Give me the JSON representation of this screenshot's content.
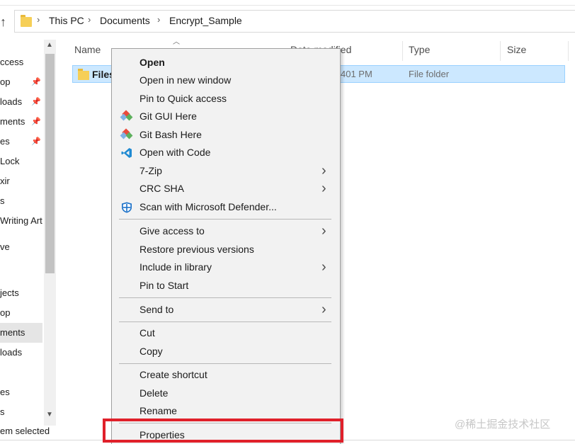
{
  "address_bar": {
    "crumbs": [
      "This PC",
      "Documents",
      "Encrypt_Sample"
    ]
  },
  "nav": {
    "items": [
      "ccess",
      "op",
      "loads",
      "ments",
      "es",
      "Lock",
      "xir",
      "s",
      "Writing Art",
      "ve",
      "jects",
      "op",
      "ments",
      "loads",
      "es",
      "s"
    ]
  },
  "columns": {
    "name": "Name",
    "date_modified": "Date modified",
    "type": "Type",
    "size": "Size"
  },
  "file": {
    "name": "Files",
    "date": "401 PM",
    "type": "File folder"
  },
  "status_bar": {
    "text": "em selected"
  },
  "watermark": "@稀土掘金技术社区",
  "context_menu": {
    "items": [
      {
        "label": "Open",
        "bold": true
      },
      {
        "label": "Open in new window"
      },
      {
        "label": "Pin to Quick access"
      },
      {
        "label": "Git GUI Here",
        "icon": "git-icon"
      },
      {
        "label": "Git Bash Here",
        "icon": "git-icon"
      },
      {
        "label": "Open with Code",
        "icon": "vscode-icon"
      },
      {
        "label": "7-Zip",
        "submenu": true
      },
      {
        "label": "CRC SHA",
        "submenu": true
      },
      {
        "label": "Scan with Microsoft Defender...",
        "icon": "defender-icon"
      },
      {
        "label": "Give access to",
        "submenu": true
      },
      {
        "label": "Restore previous versions"
      },
      {
        "label": "Include in library",
        "submenu": true
      },
      {
        "label": "Pin to Start"
      },
      {
        "label": "Send to",
        "submenu": true
      },
      {
        "label": "Cut"
      },
      {
        "label": "Copy"
      },
      {
        "label": "Create shortcut"
      },
      {
        "label": "Delete"
      },
      {
        "label": "Rename"
      },
      {
        "label": "Properties"
      }
    ]
  },
  "colors": {
    "selection": "#cce8ff",
    "highlight_box": "#e0202a",
    "menu_bg": "#f2f2f2"
  }
}
